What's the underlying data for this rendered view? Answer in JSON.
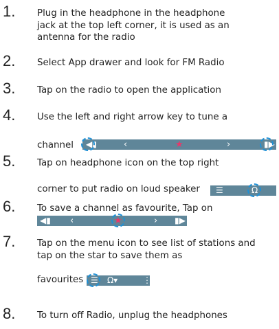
{
  "steps": [
    {
      "num": "1.",
      "text": "Plug in the headphone in the headphone jack at the top left corner, it is used as an antenna for the radio"
    },
    {
      "num": "2.",
      "text": "Select App drawer and look for FM Radio"
    },
    {
      "num": "3.",
      "text": "Tap on the radio to open the application"
    },
    {
      "num": "4.",
      "text": "Use the left and right arrow key to tune a",
      "text2": "channel"
    },
    {
      "num": "5.",
      "text": "Tap on headphone icon on the top right",
      "text2": "corner to put radio on loud speaker"
    },
    {
      "num": "6.",
      "text": "To save a channel as favourite, Tap on"
    },
    {
      "num": "7.",
      "text": "Tap on the menu icon to see list of stations and tap on the star to save them as",
      "text2": "favourites"
    },
    {
      "num": "8.",
      "text": "To turn off Radio, unplug the headphones"
    }
  ],
  "icons": {
    "seek_prev": "skip-previous-icon",
    "prev": "chevron-left-icon",
    "star": "star-icon",
    "next": "chevron-right-icon",
    "seek_next": "skip-next-icon",
    "menu": "list-menu-icon",
    "headphone": "headphone-icon",
    "more": "more-vert-icon"
  },
  "colors": {
    "bar": "#5f8699",
    "highlight": "#1e90d6",
    "star": "#e8386a"
  }
}
